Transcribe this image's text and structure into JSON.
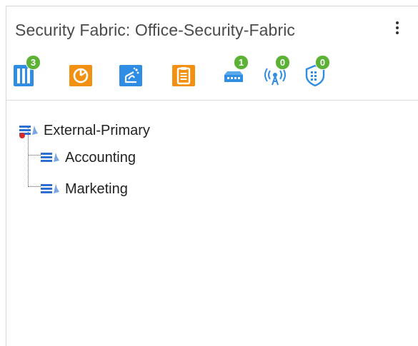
{
  "panel": {
    "title": "Security Fabric: Office-Security-Fabric",
    "menu_icon": "kebab-menu-icon"
  },
  "toolbar": {
    "items": [
      {
        "name": "fabric-topology-icon",
        "color": "#2f8de4",
        "badge": "3"
      },
      {
        "name": "timer-icon",
        "color": "#f29111",
        "badge": ""
      },
      {
        "name": "fabric-rating-icon",
        "color": "#2f8de4",
        "badge": ""
      },
      {
        "name": "clipboard-icon",
        "color": "#f29111",
        "badge": ""
      },
      {
        "name": "switch-icon",
        "color": "#2f8de4",
        "badge": "1"
      },
      {
        "name": "access-point-icon",
        "color": "#2f8de4",
        "badge": "0"
      },
      {
        "name": "endpoint-shield-icon",
        "color": "#2f8de4",
        "badge": "0"
      }
    ],
    "badge_color": "#5cb234"
  },
  "tree": {
    "root": {
      "label": "External-Primary",
      "icon": "firewall-root-icon"
    },
    "children": [
      {
        "label": "Accounting",
        "icon": "firewall-icon"
      },
      {
        "label": "Marketing",
        "icon": "firewall-icon"
      }
    ]
  }
}
